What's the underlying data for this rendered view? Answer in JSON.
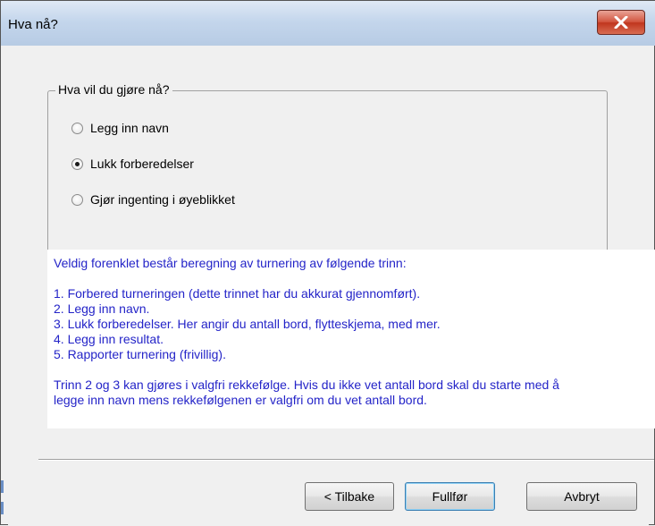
{
  "window": {
    "title": "Hva nå?"
  },
  "group": {
    "legend": "Hva vil du gjøre nå?",
    "options": [
      {
        "label": "Legg inn navn",
        "selected": false
      },
      {
        "label": "Lukk forberedelser",
        "selected": true
      },
      {
        "label": "Gjør ingenting i øyeblikket",
        "selected": false
      }
    ]
  },
  "info": {
    "intro": "Veldig forenklet består beregning av turnering av følgende trinn:",
    "steps": [
      "1. Forbered turneringen (dette trinnet har du akkurat gjennomført).",
      "2. Legg inn navn.",
      "3. Lukk forberedelser. Her angir du antall bord, flytteskjema, med mer.",
      "4. Legg inn resultat.",
      "5. Rapporter turnering (frivillig)."
    ],
    "note_line1": "Trinn 2 og 3 kan gjøres i valgfri rekkefølge. Hvis du ikke vet antall bord skal du starte med å",
    "note_line2": "legge inn navn mens rekkefølgenen er valgfri om du vet antall bord."
  },
  "buttons": {
    "back": "< Tilbake",
    "finish": "Fullfør",
    "cancel": "Avbryt"
  },
  "colors": {
    "info_text": "#2424c8",
    "close_button": "#c0351e"
  }
}
